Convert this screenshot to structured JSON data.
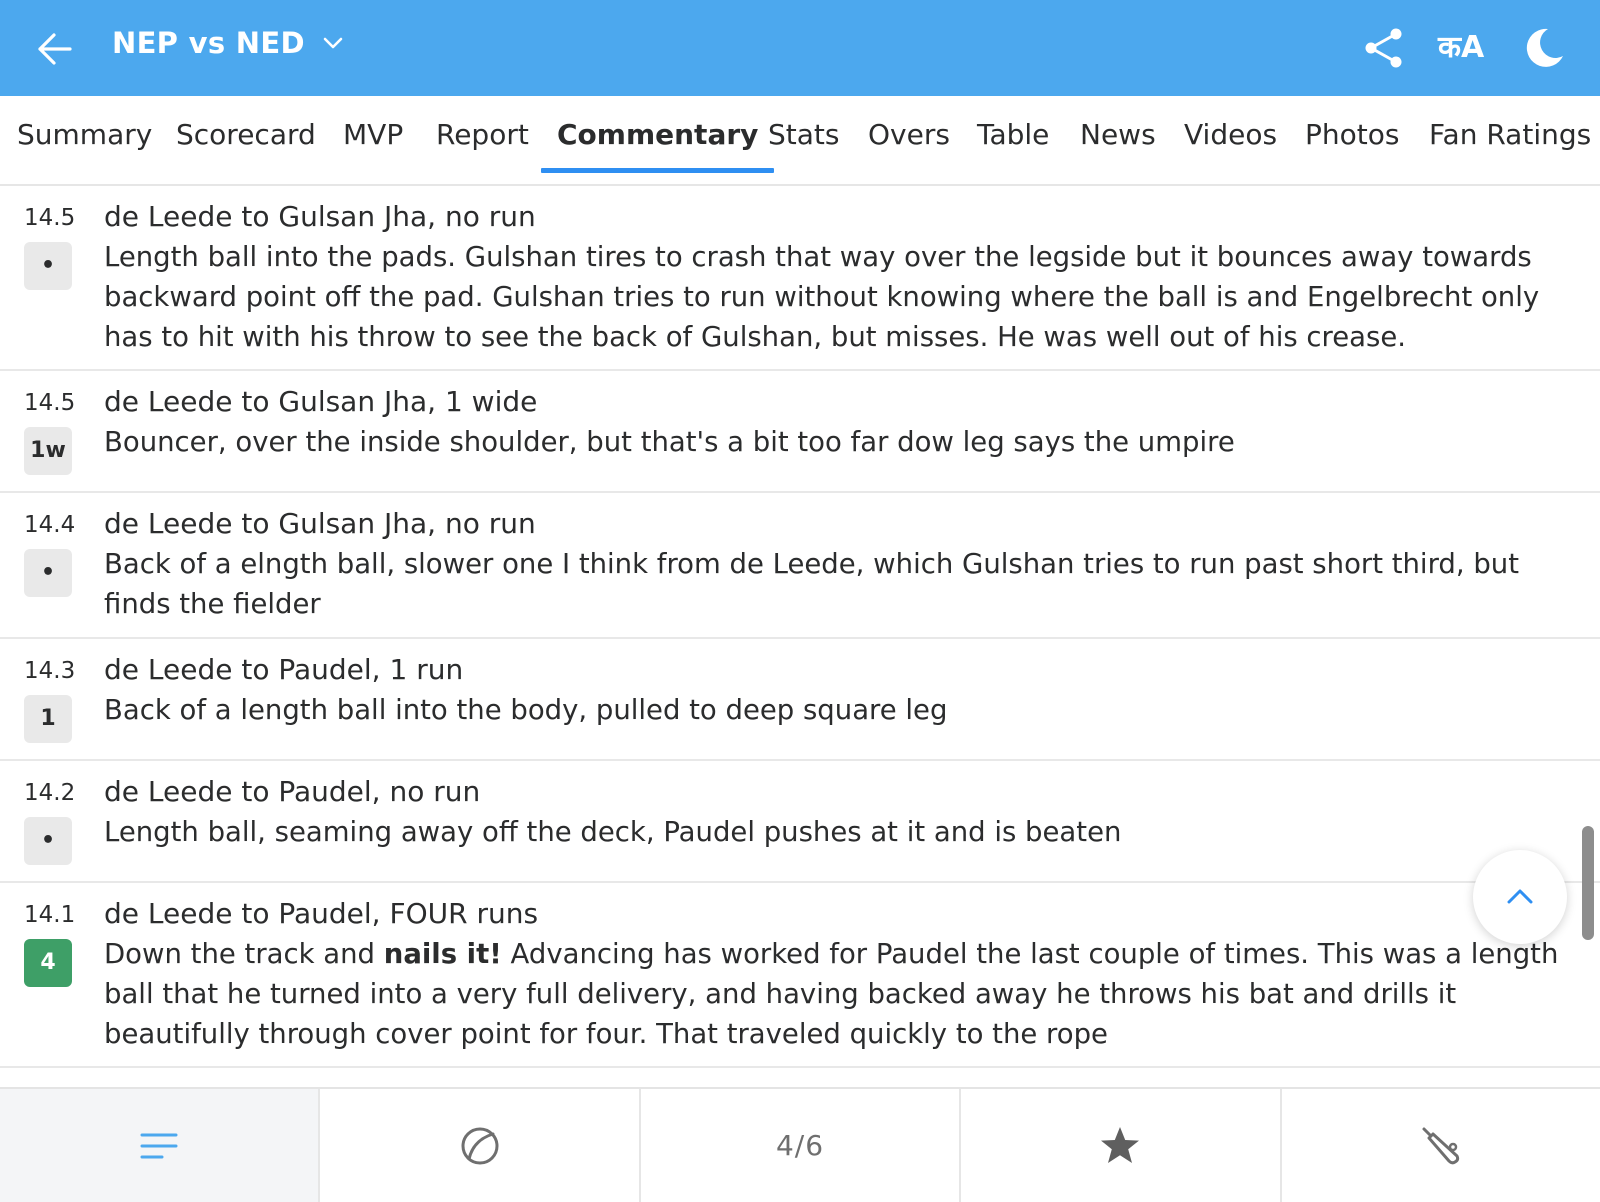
{
  "header": {
    "title": "NEP vs NED",
    "language_label": "कA"
  },
  "tabs": [
    {
      "label": "Summary"
    },
    {
      "label": "Scorecard"
    },
    {
      "label": "MVP"
    },
    {
      "label": "Report"
    },
    {
      "label": "Commentary",
      "active": true
    },
    {
      "label": "Stats"
    },
    {
      "label": "Overs"
    },
    {
      "label": "Table"
    },
    {
      "label": "News"
    },
    {
      "label": "Videos"
    },
    {
      "label": "Photos"
    },
    {
      "label": "Fan Ratings"
    }
  ],
  "commentary": [
    {
      "over": "14.5",
      "badge": "•",
      "title": "de Leede to Gulsan Jha, no run",
      "text": "Length ball into the pads. Gulshan tires to crash that way over the legside but it bounces away towards backward point off the pad. Gulshan tries to run without knowing where the ball is and Engelbrecht only has to hit with his throw to see the back of Gulshan, but misses. He was well out of his crease."
    },
    {
      "over": "14.5",
      "badge": "1w",
      "title": "de Leede to Gulsan Jha, 1 wide",
      "text": "Bouncer, over the inside shoulder, but that's a bit too far dow leg says the umpire"
    },
    {
      "over": "14.4",
      "badge": "•",
      "title": "de Leede to Gulsan Jha, no run",
      "text": "Back of a elngth ball, slower one I think from de Leede, which Gulshan tries to run past short third, but finds the fielder"
    },
    {
      "over": "14.3",
      "badge": "1",
      "title": "de Leede to Paudel, 1 run",
      "text": "Back of a length ball into the body, pulled to deep square leg"
    },
    {
      "over": "14.2",
      "badge": "•",
      "title": "de Leede to Paudel, no run",
      "text": "Length ball, seaming away off the deck, Paudel pushes at it and is beaten"
    },
    {
      "over": "14.1",
      "badge": "4",
      "title": "de Leede to Paudel, FOUR runs",
      "text_before": "Down the track and ",
      "text_bold": "nails it!",
      "text_after": " Advancing has worked for Paudel the last couple of times. This was a length ball that he turned into a very full delivery, and having backed away he throws his bat and drills it beautifully through cover point for four. That traveled quickly to the rope"
    }
  ],
  "bottom_nav": {
    "counter": "4/6"
  },
  "colors": {
    "header_bg": "#4ca8ee",
    "active_tab_underline": "#2f8ff2",
    "four_badge": "#3e9f67",
    "badge_bg": "#e9e9e9"
  },
  "icons": [
    "back-arrow-icon",
    "chevron-down-icon",
    "share-icon",
    "language-icon",
    "moon-icon",
    "chevron-up-icon",
    "list-icon",
    "ball-icon",
    "star-icon",
    "bat-icon"
  ]
}
